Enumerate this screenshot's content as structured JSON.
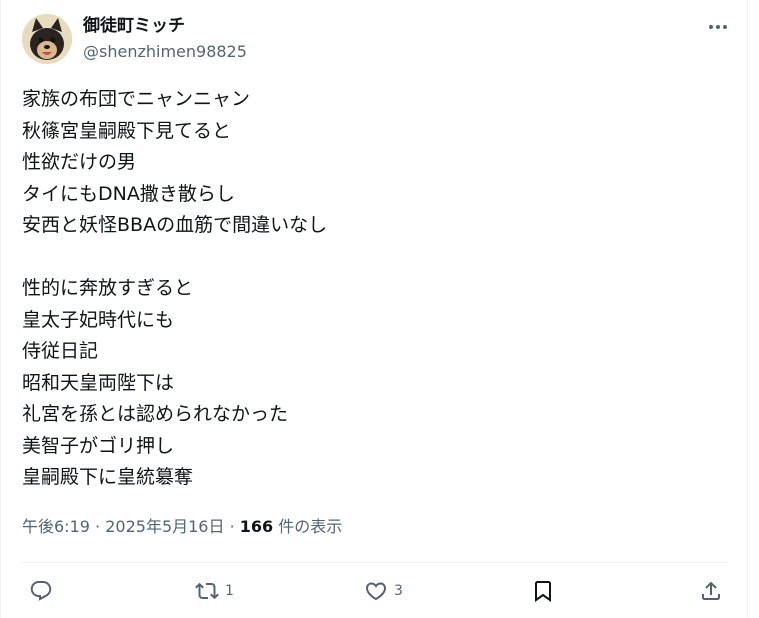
{
  "user": {
    "display_name": "御徒町ミッチ",
    "handle": "@shenzhimen98825"
  },
  "tweet": {
    "lines": [
      "家族の布団でニャンニャン",
      "秋篠宮皇嗣殿下見てると",
      "性欲だけの男",
      "タイにもDNA撒き散らし",
      "安西と妖怪BBAの血筋で間違いなし",
      "",
      "性的に奔放すぎると",
      "皇太子妃時代にも",
      "侍従日記",
      "昭和天皇両陛下は",
      "礼宮を孫とは認められなかった",
      "美智子がゴリ押し",
      "皇嗣殿下に皇統簒奪"
    ],
    "time": "午後6:19",
    "separator": "·",
    "date": "2025年5月16日",
    "views_count": "166",
    "views_label": "件の表示"
  },
  "actions": {
    "reply_count": "",
    "retweet_count": "1",
    "like_count": "3"
  },
  "icons": {
    "more": "more-dots-icon",
    "reply": "reply-icon",
    "retweet": "retweet-icon",
    "like": "heart-icon",
    "bookmark": "bookmark-icon",
    "share": "share-icon"
  },
  "colors": {
    "text": "#0f1419",
    "secondary": "#536471",
    "border": "#eff3f4"
  }
}
